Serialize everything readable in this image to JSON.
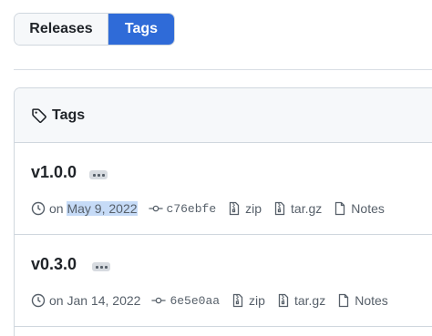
{
  "toggle": {
    "releases_label": "Releases",
    "tags_label": "Tags",
    "active": "Tags"
  },
  "box": {
    "title": "Tags",
    "icon": "tag-icon"
  },
  "tags": [
    {
      "name": "v1.0.0",
      "date_prefix": "on",
      "date": "May 9, 2022",
      "date_selected": true,
      "commit": "c76ebfe",
      "zip_label": "zip",
      "targz_label": "tar.gz",
      "notes_label": "Notes"
    },
    {
      "name": "v0.3.0",
      "date_prefix": "on",
      "date": "Jan 14, 2022",
      "date_selected": false,
      "commit": "6e5e0aa",
      "zip_label": "zip",
      "targz_label": "tar.gz",
      "notes_label": "Notes"
    }
  ],
  "colors": {
    "accent": "#2f6bd8",
    "muted_text": "#57606a",
    "border": "#d0d7de",
    "selection": "#c6dbf7"
  }
}
